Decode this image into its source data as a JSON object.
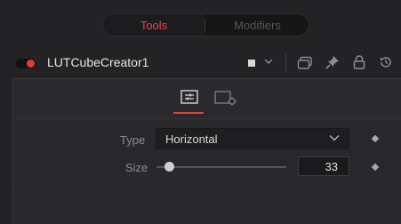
{
  "tabs": {
    "tools_label": "Tools",
    "modifiers_label": "Modifiers",
    "active": "Tools"
  },
  "node": {
    "title": "LUTCubeCreator1",
    "enabled": true,
    "toggle_color": "#e33b2e"
  },
  "header_icons": [
    "color-swatch-icon",
    "chevron-down-icon",
    "versions-icon",
    "pin-icon",
    "lock-icon",
    "reset-icon"
  ],
  "inspector": {
    "active_subtab": "settings",
    "subtabs": [
      "settings-tab-icon",
      "controls-tab-icon"
    ],
    "type": {
      "label": "Type",
      "value": "Horizontal"
    },
    "size": {
      "label": "Size",
      "value": "33",
      "slider_fraction": 0.1
    }
  },
  "colors": {
    "accent": "#e8444a",
    "background": "#232325",
    "panel": "#28282b"
  }
}
